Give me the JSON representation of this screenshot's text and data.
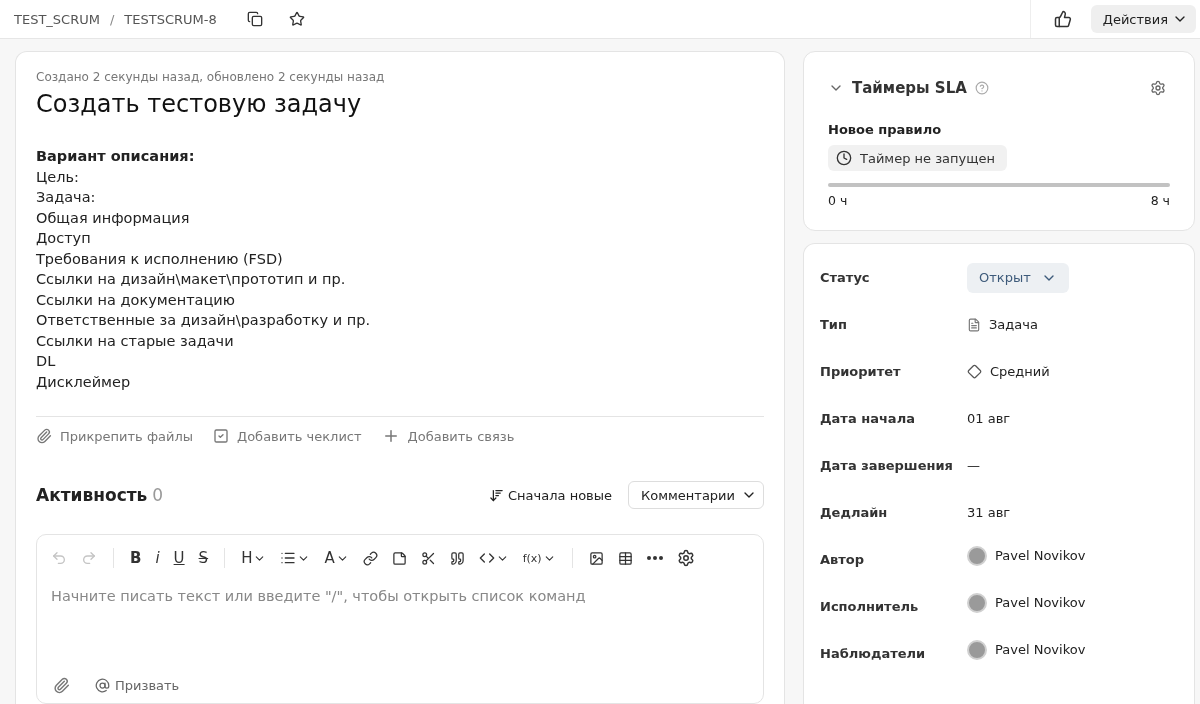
{
  "breadcrumbs": [
    "TEST_SCRUM",
    "TESTSCRUM-8"
  ],
  "breadcrumb_separator": "/",
  "header": {
    "actions_button": "Действия"
  },
  "issue": {
    "meta": "Создано 2 секунды назад, обновлено 2 секунды назад",
    "title": "Создать тестовую задачу",
    "description_heading": "Вариант описания:",
    "description_lines": [
      "Цель:",
      "Задача:",
      "Общая информация",
      "Доступ",
      "Требования к исполнению (FSD)",
      "Ссылки на дизайн\\макет\\прототип и пр.",
      "Ссылки на документацию",
      "Ответственные за дизайн\\разработку и пр.",
      "Ссылки на старые задачи",
      "DL",
      "Дисклеймер"
    ],
    "actions": [
      {
        "kind": "attach",
        "label": "Прикрепить файлы"
      },
      {
        "kind": "checklist",
        "label": "Добавить чеклист"
      },
      {
        "kind": "link",
        "label": "Добавить связь"
      }
    ]
  },
  "activity": {
    "title": "Активность",
    "count": "0",
    "sort": "Сначала новые",
    "filter": "Комментарии"
  },
  "editor": {
    "toolbar": [
      {
        "kind": "undo",
        "disabled": true,
        "dropdown": false
      },
      {
        "kind": "redo",
        "disabled": true,
        "dropdown": false
      },
      {
        "kind": "separator"
      },
      {
        "kind": "bold",
        "label": "B",
        "disabled": false,
        "dropdown": false
      },
      {
        "kind": "italic",
        "label": "i",
        "disabled": false,
        "dropdown": false
      },
      {
        "kind": "underline",
        "label": "U",
        "disabled": false,
        "dropdown": false
      },
      {
        "kind": "strike",
        "label": "S",
        "disabled": false,
        "dropdown": false
      },
      {
        "kind": "separator"
      },
      {
        "kind": "heading",
        "label": "H",
        "disabled": false,
        "dropdown": true
      },
      {
        "kind": "list",
        "disabled": false,
        "dropdown": true
      },
      {
        "kind": "color",
        "label": "A",
        "disabled": false,
        "dropdown": true
      },
      {
        "kind": "link",
        "disabled": false,
        "dropdown": false
      },
      {
        "kind": "note",
        "disabled": false,
        "dropdown": false
      },
      {
        "kind": "cut",
        "disabled": false,
        "dropdown": false
      },
      {
        "kind": "quote",
        "disabled": false,
        "dropdown": false
      },
      {
        "kind": "code",
        "disabled": false,
        "dropdown": true
      },
      {
        "kind": "formula",
        "label": "f(x)",
        "disabled": false,
        "dropdown": true
      },
      {
        "kind": "separator"
      },
      {
        "kind": "image",
        "disabled": false,
        "dropdown": false
      },
      {
        "kind": "table",
        "disabled": false,
        "dropdown": false
      },
      {
        "kind": "more",
        "disabled": false,
        "dropdown": false
      },
      {
        "kind": "settings",
        "disabled": false,
        "dropdown": false
      }
    ],
    "placeholder": "Начните писать текст или введите \"/\", чтобы открыть список команд",
    "mention": "Призвать"
  },
  "sla": {
    "title": "Таймеры SLA",
    "expanded": true,
    "rule": "Новое правило",
    "timer": "Таймер не запущен",
    "start": "0 ч",
    "end": "8 ч"
  },
  "fields": [
    {
      "label": "Статус",
      "kind": "status",
      "value": "Открыт"
    },
    {
      "label": "Тип",
      "kind": "type",
      "value": "Задача"
    },
    {
      "label": "Приоритет",
      "kind": "priority",
      "value": "Средний"
    },
    {
      "label": "Дата начала",
      "kind": "text",
      "value": "01 авг"
    },
    {
      "label": "Дата завершения",
      "kind": "text",
      "value": "—"
    },
    {
      "label": "Дедлайн",
      "kind": "text",
      "value": "31 авг"
    },
    {
      "label": "Автор",
      "kind": "user",
      "value": "Pavel Novikov"
    },
    {
      "label": "Исполнитель",
      "kind": "user",
      "value": "Pavel Novikov"
    },
    {
      "label": "Наблюдатели",
      "kind": "user",
      "value": "Pavel Novikov"
    }
  ]
}
